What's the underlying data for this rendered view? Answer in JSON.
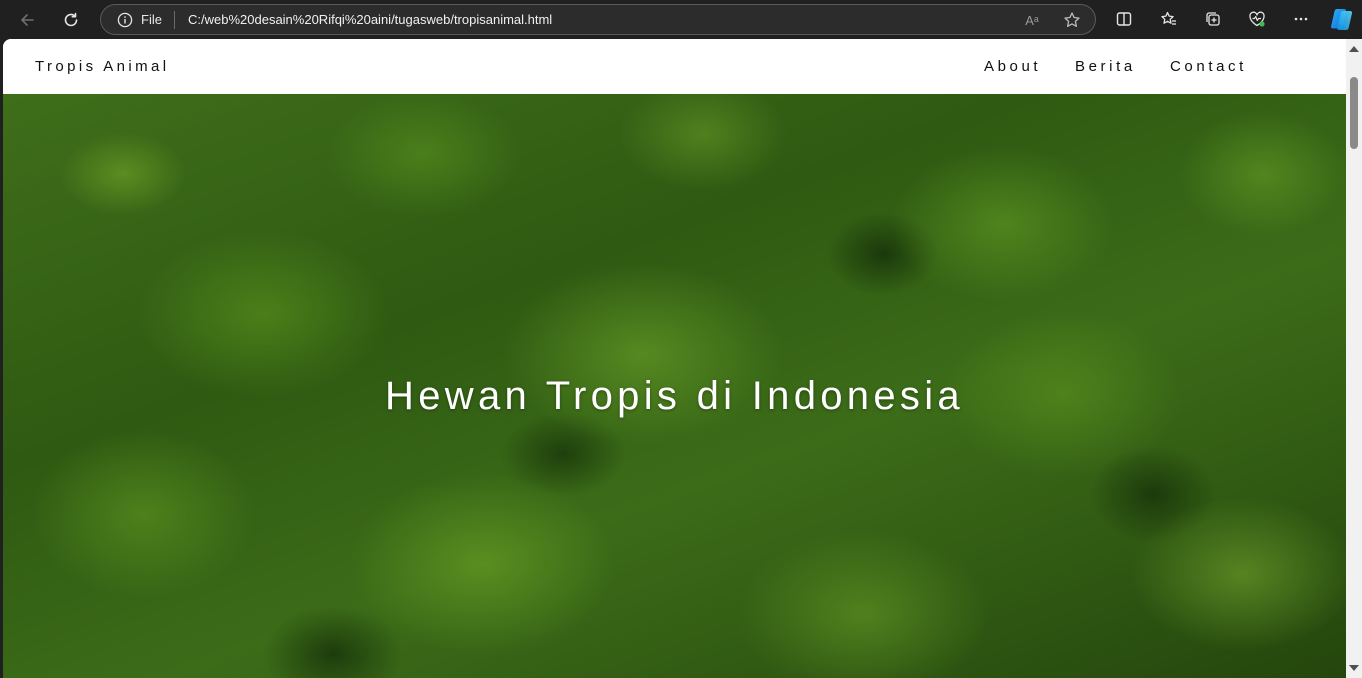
{
  "browser": {
    "address_scheme": "File",
    "url": "C:/web%20desain%20Rifqi%20aini/tugasweb/tropisanimal.html",
    "read_aloud_glyph": "Aᵃ"
  },
  "site": {
    "brand": "Tropis Animal",
    "menu": [
      {
        "label": "About"
      },
      {
        "label": "Berita"
      },
      {
        "label": "Contact"
      }
    ],
    "hero_title": "Hewan Tropis di Indonesia"
  },
  "colors": {
    "browser_bg": "#202020",
    "nav_bg": "#ffffff",
    "hero_green": "#3c6c18",
    "hero_text": "#ffffff"
  }
}
